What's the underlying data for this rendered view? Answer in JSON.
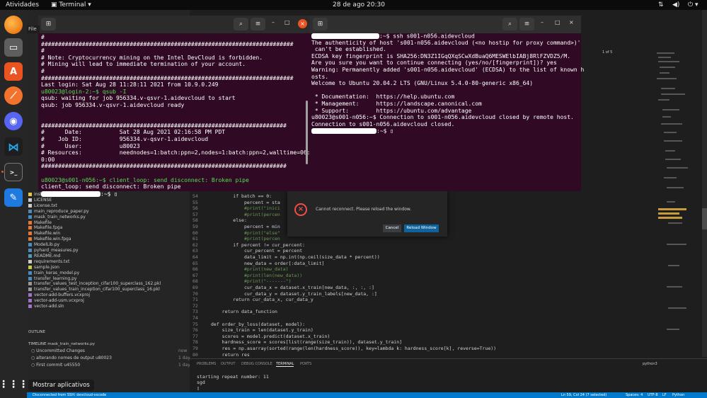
{
  "topbar": {
    "activities": "Atividades",
    "app": "Terminal",
    "clock": "28 de ago  20:30"
  },
  "dock": {
    "tooltip": "Mostrar aplicativos"
  },
  "term_left": {
    "lines": [
      "#",
      "##########################################################################",
      "#",
      "# Note: Cryptocurrency mining on the Intel DevCloud is forbidden.",
      "# Mining will lead to immediate termination of your account.",
      "#",
      "##########################################################################",
      "Last login: Sat Aug 28 11:28:11 2021 from 10.9.0.249",
      "u80023@login-2:~$ qsub -I",
      "qsub: waiting for job 956334.v-qsvr-1.aidevcloud to start",
      "qsub: job 956334.v-qsvr-1.aidevcloud ready",
      "",
      "",
      "########################################################################",
      "#      Date:           Sat 28 Aug 2021 02:16:58 PM PDT",
      "#    Job ID:           956334.v-qsvr-1.aidevcloud",
      "#      User:           u80023",
      "# Resources:           neednodes=1:batch:ppn=2,nodes=1:batch:ppn=2,walltime=06:0",
      "0:00",
      "########################################################################",
      "",
      "u80023@s001-n056:~$ client_loop: send disconnect: Broken pipe",
      "client_loop: send disconnect: Broken pipe",
      ":~$ "
    ]
  },
  "term_right": {
    "lines": [
      ":~$ ssh s001-n056.aidevcloud",
      "The authenticity of host 's001-n056.aidevcloud (<no hostip for proxy command>)'",
      " can't be established.",
      "ECDSA key fingerprint is SHA256:DN3Z1IGqQXqSCwXdBuaQ6MESWElbIABj8RlFZVDZ5/M.",
      "Are you sure you want to continue connecting (yes/no/[fingerprint])? yes",
      "Warning: Permanently added 's001-n056.aidevcloud' (ECDSA) to the list of known h",
      "osts.",
      "Welcome to Ubuntu 20.04.2 LTS (GNU/Linux 5.4.0-80-generic x86_64)",
      "",
      " * Documentation:  https://help.ubuntu.com",
      " * Management:     https://landscape.canonical.com",
      " * Support:        https://ubuntu.com/advantage",
      "u80023@s001-n056:~$ Connection to s001-n056.aidevcloud closed by remote host.",
      "Connection to s001-n056.aidevcloud closed.",
      ":~$ "
    ],
    "find_count": "1 of 5"
  },
  "left_menu": "File",
  "sidebar_files": [
    "instance_hardness.py",
    "LICENSE",
    "License.txt",
    "main_reproduce_paper.py",
    "mask_train_networks.py",
    "Makefile",
    "Makefile.fpga",
    "Makefile.win",
    "Makefile.win.fpga",
    "ModelLib.py",
    "pyhard_measures.py",
    "README.md",
    "requirements.txt",
    "sample.json",
    "train_keras_model.py",
    "transfer_learning.py",
    "transfer_values_test_inception_cifar100_superclass_162.pkl",
    "transfer_values_train_inception_cifar100_superclass_16.pkl",
    "vector-add-buffers.vcxproj",
    "vector-add-usm.vcxproj",
    "vector-add.sln"
  ],
  "outline_label": "OUTLINE",
  "timeline": {
    "label": "TIMELINE  mask_train_networks.py",
    "items": [
      {
        "text": "Uncommitted Changes",
        "time": "now"
      },
      {
        "text": "alterando nomes de output  u80023",
        "time": "1 day"
      },
      {
        "text": "First commit  u45550",
        "time": "1 day"
      }
    ]
  },
  "editor_lines": [
    {
      "n": "54",
      "t": "        if batch == 0:"
    },
    {
      "n": "55",
      "t": "            percent = sta"
    },
    {
      "n": "56",
      "t": "            #print(\"inici"
    },
    {
      "n": "57",
      "t": "            #print(percen"
    },
    {
      "n": "58",
      "t": "        else:"
    },
    {
      "n": "59",
      "t": "            percent = min"
    },
    {
      "n": "60",
      "t": "            #print(\"else\""
    },
    {
      "n": "61",
      "t": "            #print(percen"
    },
    {
      "n": "62",
      "t": "        if percent != cur_percent:"
    },
    {
      "n": "63",
      "t": "            cur_percent = percent"
    },
    {
      "n": "64",
      "t": "            data_limit = np.int(np.ceil(size_data * percent))"
    },
    {
      "n": "65",
      "t": "            new_data = order[:data_limit]"
    },
    {
      "n": "66",
      "t": "            #print(new_data)"
    },
    {
      "n": "67",
      "t": "            #print(len(new_data))"
    },
    {
      "n": "68",
      "t": "            #print(\"-------\")"
    },
    {
      "n": "69",
      "t": "            cur_data_x = dataset.x_train[new_data, :, :, :]"
    },
    {
      "n": "70",
      "t": "            cur_data_y = dataset.y_train_labels[new_data, :]"
    },
    {
      "n": "71",
      "t": "        return cur_data_x, cur_data_y"
    },
    {
      "n": "72",
      "t": ""
    },
    {
      "n": "73",
      "t": "    return data_function"
    },
    {
      "n": "74",
      "t": ""
    },
    {
      "n": "75",
      "t": "def order_by_loss(dataset, model):"
    },
    {
      "n": "76",
      "t": "    size_train = len(dataset.y_train)"
    },
    {
      "n": "77",
      "t": "    scores = model.predict(dataset.x_train)"
    },
    {
      "n": "78",
      "t": "    hardness_score = scores[list(range(size_train)), dataset.y_train]"
    },
    {
      "n": "79",
      "t": "    res = np.asarray(sorted(range(len(hardness_score)), key=lambda k: hardness_score[k], reverse=True))"
    },
    {
      "n": "80",
      "t": "    return res"
    },
    {
      "n": "81",
      "t": ""
    }
  ],
  "dialog": {
    "message": "Cannot reconnect. Please reload the window.",
    "cancel": "Cancel",
    "reload": "Reload Window"
  },
  "panel": {
    "tabs": [
      "PROBLEMS",
      "OUTPUT",
      "DEBUG CONSOLE",
      "TERMINAL",
      "PORTS"
    ],
    "terminal_lines": [
      "starting repeat number: 11",
      "sgd",
      "▯"
    ],
    "shell": "python3"
  },
  "statusbar": {
    "remote": "Disconnected from SSH: devcloud-vscode",
    "position": "Ln 59, Col 24 (7 selected)",
    "spaces": "Spaces: 4",
    "encoding": "UTF-8",
    "eol": "LF",
    "language": "Python"
  }
}
